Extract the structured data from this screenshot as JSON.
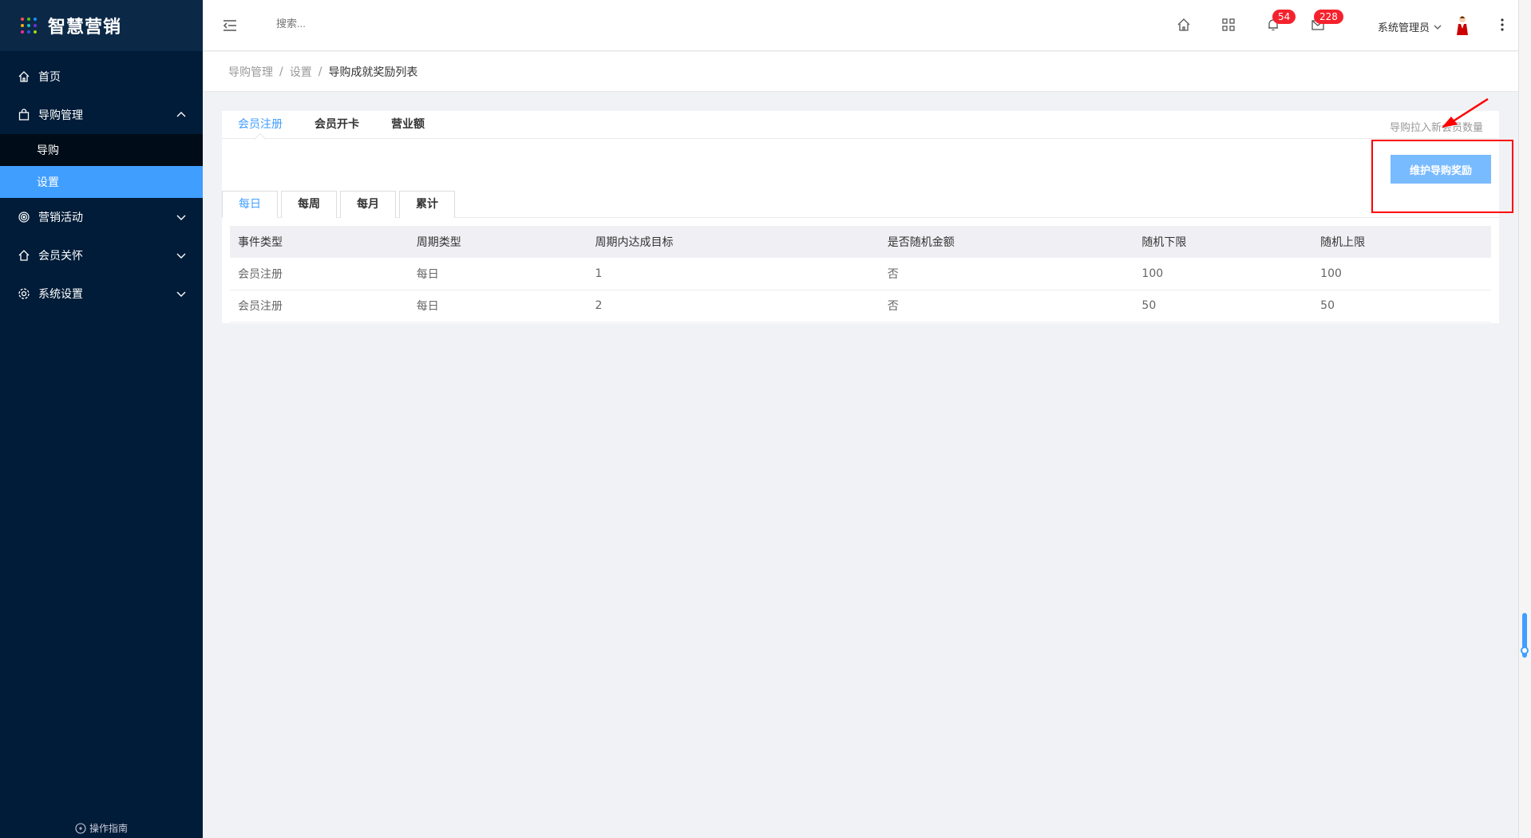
{
  "sidebar": {
    "logo_text": "智慧营销",
    "logo_colors": [
      "#ff4d4f",
      "#52c41a",
      "#1890ff",
      "#faad14",
      "#13c2c2",
      "#722ed1",
      "#eb2f96",
      "#2f54eb",
      "#a0d911"
    ],
    "items": [
      {
        "label": "首页",
        "icon": "home-icon"
      },
      {
        "label": "导购管理",
        "icon": "bag-icon",
        "expanded": true,
        "children": [
          {
            "label": "导购"
          },
          {
            "label": "设置",
            "active": true
          }
        ]
      },
      {
        "label": "营销活动",
        "icon": "target-icon"
      },
      {
        "label": "会员关怀",
        "icon": "house-icon"
      },
      {
        "label": "系统设置",
        "icon": "gear-icon"
      }
    ],
    "guide_label": "操作指南"
  },
  "header": {
    "search_placeholder": "搜索...",
    "notifications_count": "54",
    "messages_count": "228",
    "user_name": "系统管理员"
  },
  "breadcrumb": {
    "items": [
      "导购管理",
      "设置"
    ],
    "current": "导购成就奖励列表"
  },
  "main": {
    "tabs": [
      {
        "label": "会员注册",
        "active": true
      },
      {
        "label": "会员开卡"
      },
      {
        "label": "营业额"
      }
    ],
    "tab_hint": "导购拉入新会员数量",
    "maintain_button": "维护导购奖励",
    "period_tabs": [
      {
        "label": "每日",
        "active": true
      },
      {
        "label": "每周"
      },
      {
        "label": "每月"
      },
      {
        "label": "累计"
      }
    ],
    "table": {
      "headers": [
        "事件类型",
        "周期类型",
        "周期内达成目标",
        "是否随机金额",
        "随机下限",
        "随机上限"
      ],
      "rows": [
        [
          "会员注册",
          "每日",
          "1",
          "否",
          "100",
          "100"
        ],
        [
          "会员注册",
          "每日",
          "2",
          "否",
          "50",
          "50"
        ]
      ]
    }
  },
  "colors": {
    "sidebar_bg": "#001c38",
    "accent": "#409eff",
    "badge": "#f5222d",
    "annotation": "#ff0000"
  }
}
